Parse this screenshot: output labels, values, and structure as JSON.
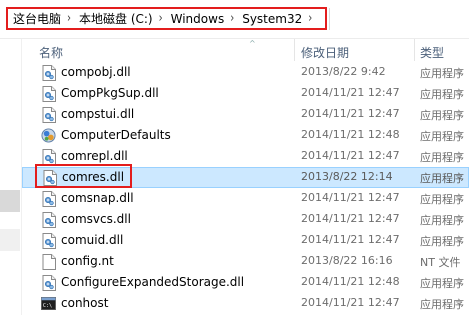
{
  "address": {
    "crumbs": [
      "这台电脑",
      "本地磁盘 (C:)",
      "Windows",
      "System32"
    ],
    "separator": "›"
  },
  "columns": {
    "name": "名称",
    "date": "修改日期",
    "type": "类型"
  },
  "files": [
    {
      "name": "compobj.dll",
      "date": "2013/8/22 9:42",
      "type": "应用程序",
      "icon": "dll-icon"
    },
    {
      "name": "CompPkgSup.dll",
      "date": "2014/11/21 12:47",
      "type": "应用程序",
      "icon": "dll-icon"
    },
    {
      "name": "compstui.dll",
      "date": "2014/11/21 12:47",
      "type": "应用程序",
      "icon": "dll-icon"
    },
    {
      "name": "ComputerDefaults",
      "date": "2014/11/21 12:48",
      "type": "应用程序",
      "icon": "app-icon"
    },
    {
      "name": "comrepl.dll",
      "date": "2014/11/21 12:47",
      "type": "应用程序",
      "icon": "dll-icon"
    },
    {
      "name": "comres.dll",
      "date": "2013/8/22 12:14",
      "type": "应用程序",
      "icon": "dll-icon",
      "selected": true
    },
    {
      "name": "comsnap.dll",
      "date": "2014/11/21 12:47",
      "type": "应用程序",
      "icon": "dll-icon"
    },
    {
      "name": "comsvcs.dll",
      "date": "2014/11/21 12:47",
      "type": "应用程序",
      "icon": "dll-icon"
    },
    {
      "name": "comuid.dll",
      "date": "2014/11/21 12:47",
      "type": "应用程序",
      "icon": "dll-icon"
    },
    {
      "name": "config.nt",
      "date": "2013/8/22 16:16",
      "type": "NT 文件",
      "icon": "text-file-icon"
    },
    {
      "name": "ConfigureExpandedStorage.dll",
      "date": "2014/11/21 12:48",
      "type": "应用程序",
      "icon": "dll-icon"
    },
    {
      "name": "conhost",
      "date": "2014/11/21 12:47",
      "type": "应用程序",
      "icon": "console-icon"
    }
  ],
  "colors": {
    "highlight_border": "#e31d1d",
    "selection_bg": "#cce8ff",
    "selection_border": "#99d1ff",
    "header_text": "#4c607a"
  }
}
